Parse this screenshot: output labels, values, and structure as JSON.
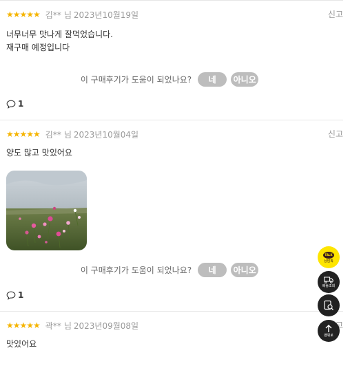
{
  "reviews": [
    {
      "rating": "★★★★★",
      "author": "김**",
      "suffix": "님",
      "date": "2023년10월19일",
      "report_label": "신고",
      "lines": [
        "너무너무 맛나게 잘먹었습니다.",
        "재구매 예정입니다"
      ],
      "helpful_question": "이 구매후기가 도움이 되었나요?",
      "yes_label": "네",
      "no_label": "아니오",
      "comment_count": "1"
    },
    {
      "rating": "★★★★★",
      "author": "김**",
      "suffix": "님",
      "date": "2023년10월04일",
      "report_label": "신고",
      "lines": [
        "양도 많고 맛있어요"
      ],
      "helpful_question": "이 구매후기가 도움이 되었나요?",
      "yes_label": "네",
      "no_label": "아니오",
      "comment_count": "1"
    },
    {
      "rating": "★★★★★",
      "author": "곽**",
      "suffix": "님",
      "date": "2023년09월08일",
      "report_label": "신고",
      "lines": [
        "맛있어요"
      ]
    }
  ],
  "floating": {
    "kakao_label": "상담톡",
    "kakao_logo": "TALK",
    "delivery_label": "배송조회",
    "top_label": "맨위로"
  },
  "colors": {
    "star": "#f5b400",
    "pill": "#bdbdbd",
    "kakao": "#fee500",
    "dark_button": "#222222"
  }
}
